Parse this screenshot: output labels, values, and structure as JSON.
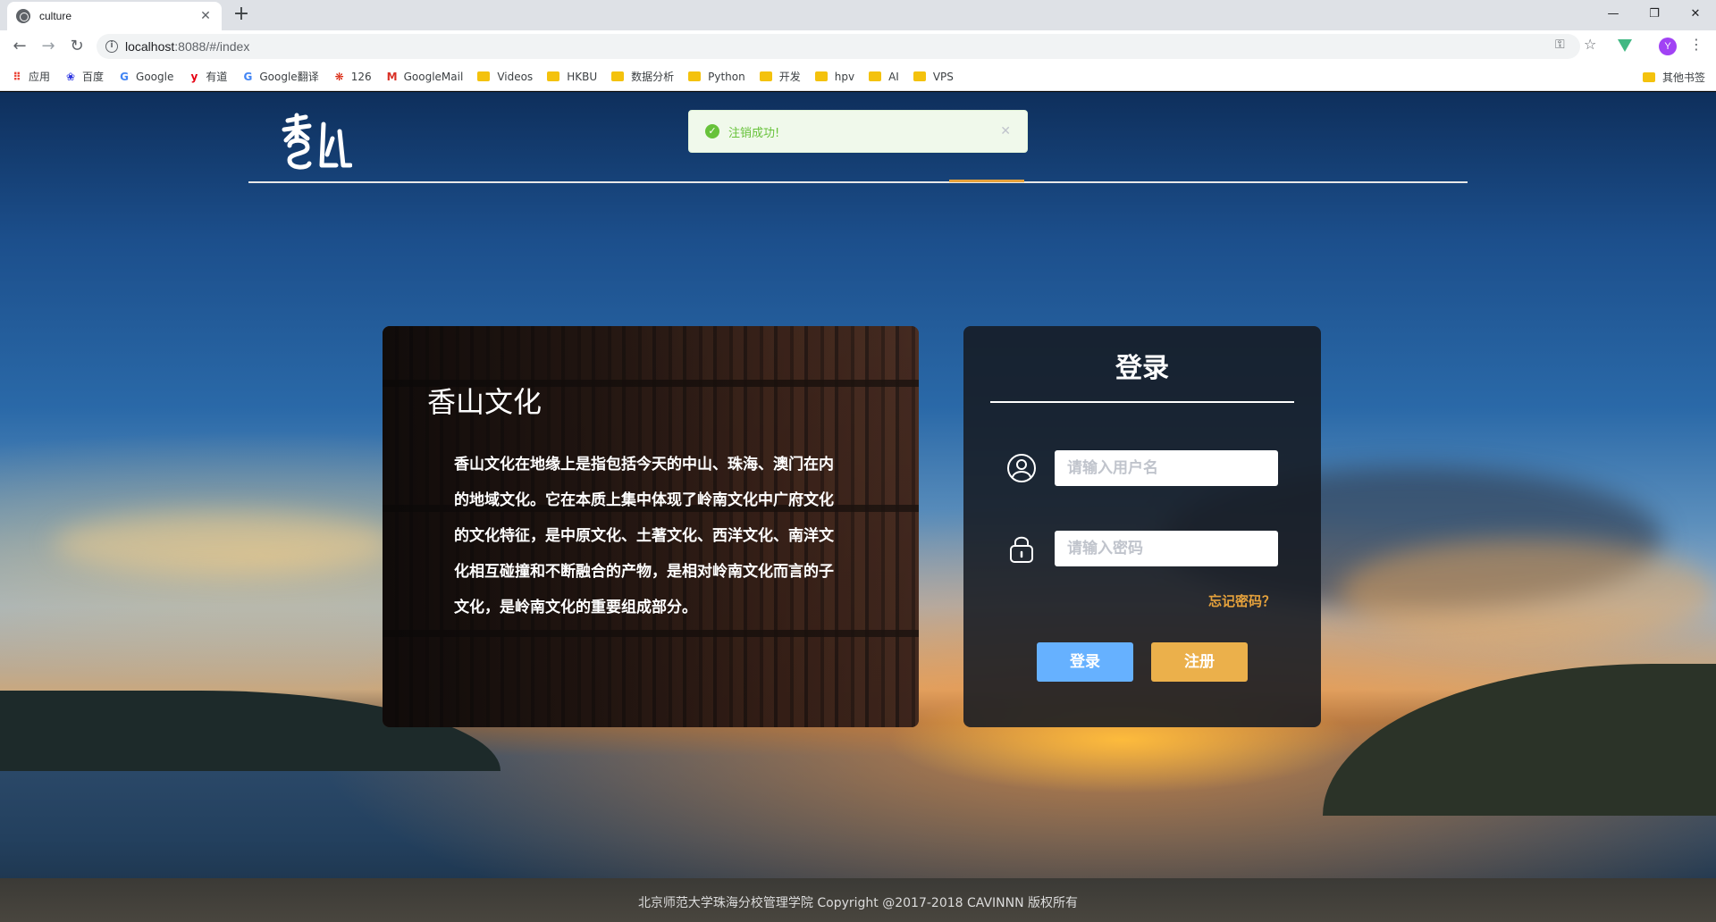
{
  "browser": {
    "tab_title": "culture",
    "url_host": "localhost",
    "url_rest": ":8088/#/index",
    "avatar_letter": "Y",
    "bookmarks": [
      {
        "label": "应用",
        "icon": "apps-grid-icon",
        "color": "#ea4335"
      },
      {
        "label": "百度",
        "icon": "baidu-icon",
        "color": "#2932e1"
      },
      {
        "label": "Google",
        "icon": "google-icon",
        "color": "#4285f4"
      },
      {
        "label": "有道",
        "icon": "youdao-icon",
        "color": "#e60012"
      },
      {
        "label": "Google翻译",
        "icon": "google-translate-icon",
        "color": "#4285f4"
      },
      {
        "label": "126",
        "icon": "netease-126-icon",
        "color": "#d81e06"
      },
      {
        "label": "GoogleMail",
        "icon": "gmail-icon",
        "color": "#d93025"
      },
      {
        "label": "Videos",
        "icon": "folder-icon"
      },
      {
        "label": "HKBU",
        "icon": "folder-icon"
      },
      {
        "label": "数据分析",
        "icon": "folder-icon"
      },
      {
        "label": "Python",
        "icon": "folder-icon"
      },
      {
        "label": "开发",
        "icon": "folder-icon"
      },
      {
        "label": "hpv",
        "icon": "folder-icon"
      },
      {
        "label": "AI",
        "icon": "folder-icon"
      },
      {
        "label": "VPS",
        "icon": "folder-icon"
      }
    ],
    "other_bookmarks": "其他书签"
  },
  "notification": {
    "text": "注销成功!",
    "type": "success",
    "color": "#67c23a"
  },
  "intro": {
    "title": "香山文化",
    "body": "香山文化在地缘上是指包括今天的中山、珠海、澳门在内的地域文化。它在本质上集中体现了岭南文化中广府文化的文化特征，是中原文化、土著文化、西洋文化、南洋文化相互碰撞和不断融合的产物，是相对岭南文化而言的子文化，是岭南文化的重要组成部分。"
  },
  "login": {
    "title": "登录",
    "username_placeholder": "请输入用户名",
    "password_placeholder": "请输入密码",
    "forgot_label": "忘记密码？",
    "login_button": "登录",
    "register_button": "注册",
    "accent_login": "#66b1ff",
    "accent_register": "#ebb04b"
  },
  "footer": {
    "text": "北京师范大学珠海分校管理学院 Copyright @2017-2018 CAVINNN 版权所有"
  }
}
